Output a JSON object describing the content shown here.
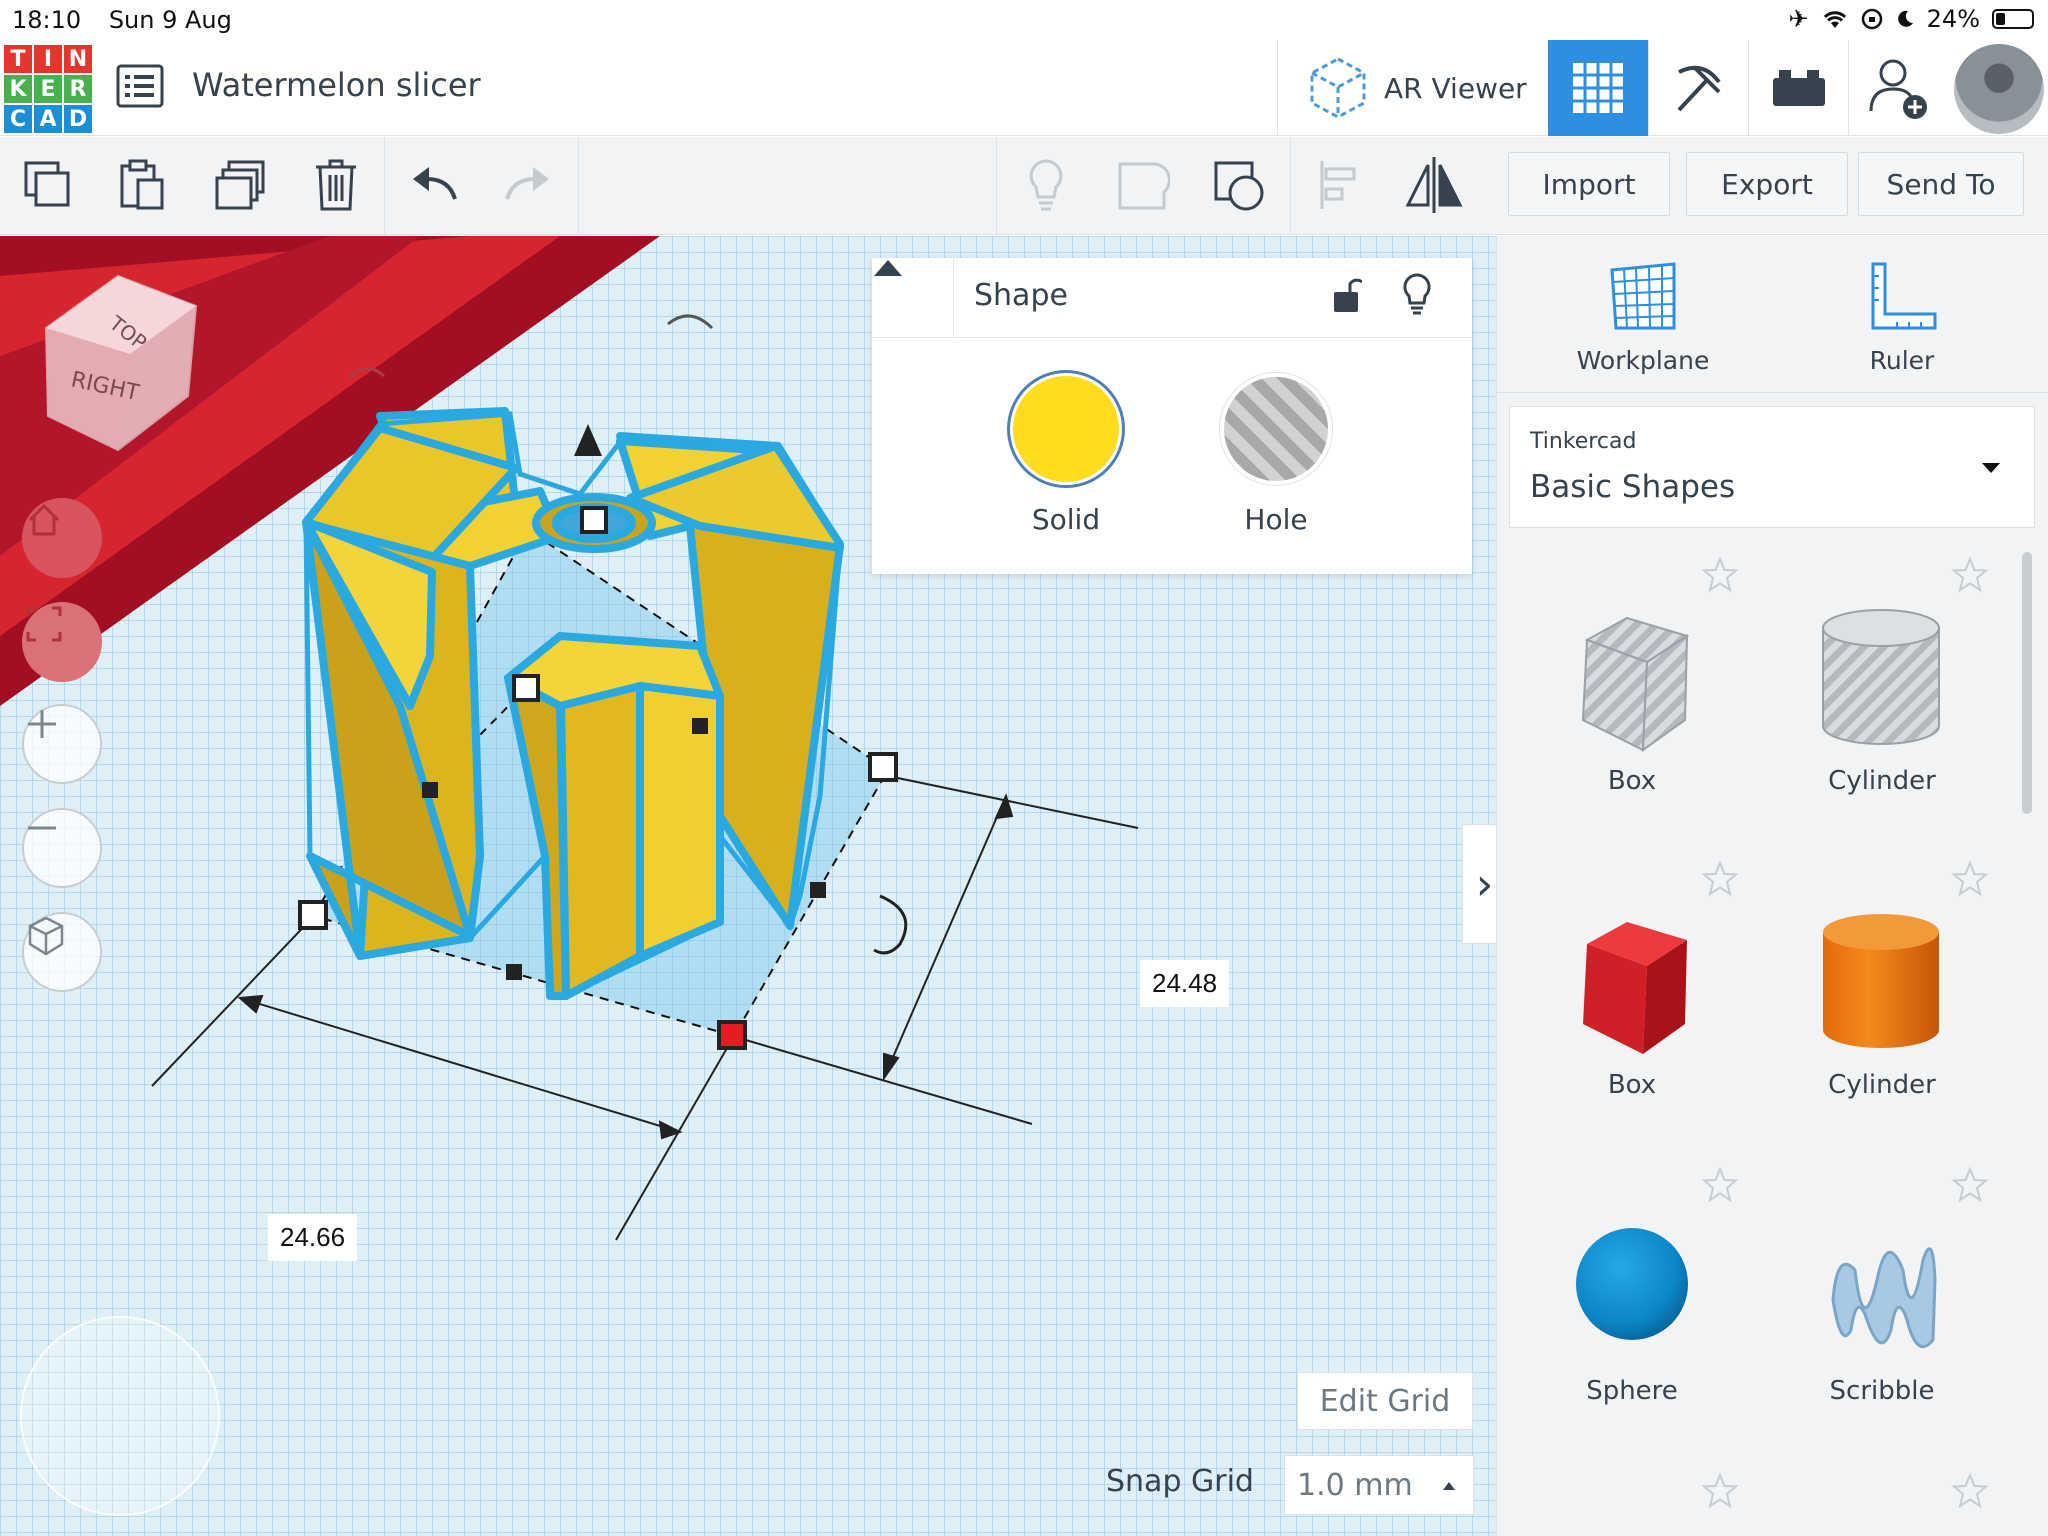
{
  "status_bar": {
    "time": "18:10",
    "date": "Sun 9 Aug",
    "battery": "24%"
  },
  "logo_letters": [
    "T",
    "I",
    "N",
    "K",
    "E",
    "R",
    "C",
    "A",
    "D"
  ],
  "colors": {
    "accent": "#2e8ee2",
    "logo_red": "#e5362e",
    "logo_green": "#48b04c",
    "logo_blue": "#1b8ed6",
    "solid": "#ffdc1e",
    "selection": "#2aa9e0"
  },
  "header": {
    "title": "Watermelon slicer",
    "ar_viewer": "AR Viewer"
  },
  "toolbar": {
    "import": "Import",
    "export": "Export",
    "send_to": "Send To"
  },
  "inspector": {
    "title": "Shape",
    "solid": "Solid",
    "hole": "Hole"
  },
  "dimensions": {
    "depth": "24.48",
    "width": "24.66"
  },
  "viewcube": {
    "top": "TOP",
    "right": "RIGHT"
  },
  "grid": {
    "edit_grid": "Edit Grid",
    "snap_label": "Snap Grid",
    "snap_value": "1.0 mm"
  },
  "right_panel": {
    "workplane": "Workplane",
    "ruler": "Ruler",
    "library_provider": "Tinkercad",
    "library_name": "Basic Shapes",
    "shapes": [
      {
        "label": "Box",
        "icon": "box-hole-icon"
      },
      {
        "label": "Cylinder",
        "icon": "cylinder-hole-icon"
      },
      {
        "label": "Box",
        "icon": "box-red-icon"
      },
      {
        "label": "Cylinder",
        "icon": "cylinder-orange-icon"
      },
      {
        "label": "Sphere",
        "icon": "sphere-blue-icon"
      },
      {
        "label": "Scribble",
        "icon": "scribble-icon"
      }
    ]
  }
}
